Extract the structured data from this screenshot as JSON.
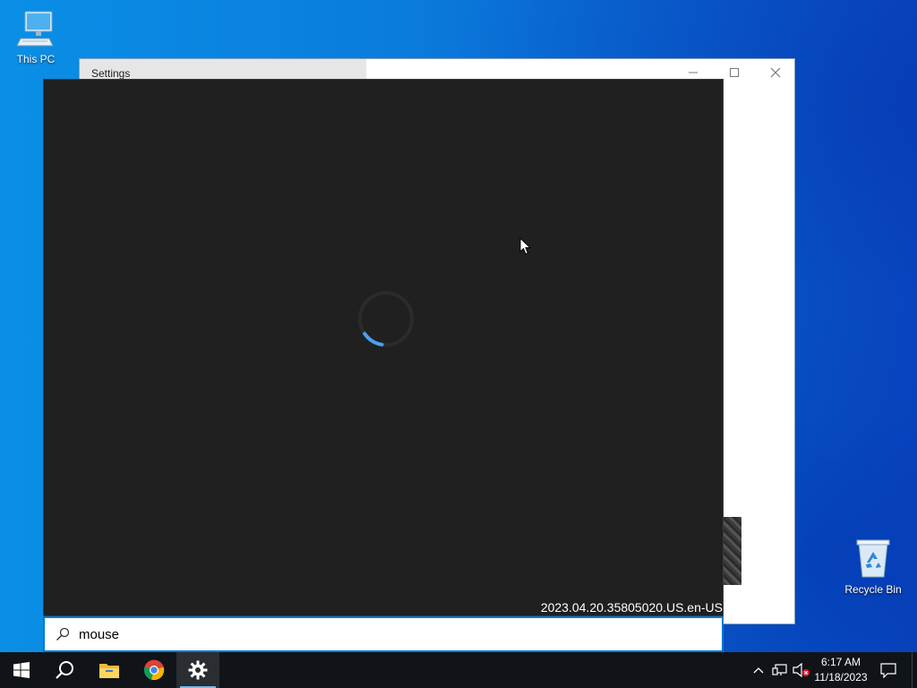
{
  "desktop": {
    "icons": [
      {
        "label": "This PC"
      },
      {
        "label": "Recycle Bin"
      }
    ]
  },
  "settings_window": {
    "title": "Settings"
  },
  "search_panel": {
    "version": "2023.04.20.35805020.US.en-US",
    "query": "mouse",
    "state": "loading"
  },
  "taskbar": {
    "pinned": [
      "start-icon",
      "search-icon",
      "file-explorer-icon",
      "chrome-icon",
      "settings-icon"
    ],
    "active": "settings-icon",
    "clock": {
      "time": "6:17 AM",
      "date": "11/18/2023"
    }
  },
  "colors": {
    "accent": "#0078d7",
    "spinner": "#4a9ff0",
    "panel_bg": "#202020",
    "taskbar_bg": "#101418"
  }
}
